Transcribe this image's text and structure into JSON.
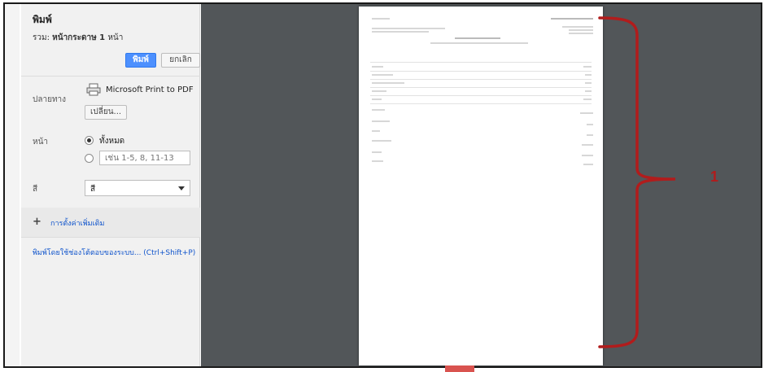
{
  "sidebar": {
    "title": "พิมพ์",
    "summary_prefix": "รวม:",
    "summary_bold": "หน้ากระดาษ 1",
    "summary_suffix": "หน้า",
    "print_button": "พิมพ์",
    "cancel_button": "ยกเลิก",
    "destination": {
      "label": "ปลายทาง",
      "printer": "Microsoft Print to PDF",
      "change_button": "เปลี่ยน...",
      "icon": "printer-icon"
    },
    "pages": {
      "label": "หน้า",
      "all_option": "ทั้งหมด",
      "range_placeholder": "เช่น 1-5, 8, 11-13"
    },
    "color": {
      "label": "สี",
      "value": "สี"
    },
    "more_settings": "การตั้งค่าเพิ่มเติม",
    "system_dialog": "พิมพ์โดยใช้ช่องโต้ตอบของระบบ... (Ctrl+Shift+P)"
  },
  "annotation": {
    "label": "1",
    "color": "#b11c1c"
  },
  "colors": {
    "preview_bg": "#525659",
    "sidebar_bg": "#f1f1f1",
    "print_button": "#4d90fe",
    "link": "#1155cc"
  }
}
